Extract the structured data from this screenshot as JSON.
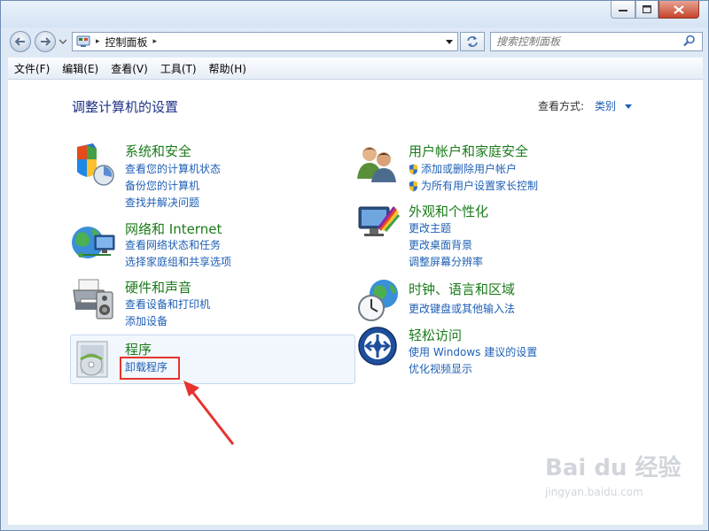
{
  "window": {
    "title": "",
    "controls": {
      "minimize": "minimize",
      "maximize": "maximize",
      "close": "close"
    }
  },
  "address": {
    "path": "控制面板",
    "separator": "▸"
  },
  "search": {
    "placeholder": "搜索控制面板"
  },
  "menu": {
    "items": [
      "文件(F)",
      "编辑(E)",
      "查看(V)",
      "工具(T)",
      "帮助(H)"
    ]
  },
  "content": {
    "heading": "调整计算机的设置",
    "view_by_label": "查看方式:",
    "view_by_value": "类别",
    "categories": [
      {
        "title": "系统和安全",
        "links": [
          "查看您的计算机状态",
          "备份您的计算机",
          "查找并解决问题"
        ]
      },
      {
        "title": "网络和 Internet",
        "links": [
          "查看网络状态和任务",
          "选择家庭组和共享选项"
        ]
      },
      {
        "title": "硬件和声音",
        "links": [
          "查看设备和打印机",
          "添加设备"
        ]
      },
      {
        "title": "程序",
        "links": [
          "卸载程序"
        ]
      },
      {
        "title": "用户帐户和家庭安全",
        "links": [
          "添加或删除用户帐户",
          "为所有用户设置家长控制"
        ]
      },
      {
        "title": "外观和个性化",
        "links": [
          "更改主题",
          "更改桌面背景",
          "调整屏幕分辨率"
        ]
      },
      {
        "title": "时钟、语言和区域",
        "links": [
          "更改键盘或其他输入法"
        ]
      },
      {
        "title": "轻松访问",
        "links": [
          "使用 Windows 建议的设置",
          "优化视频显示"
        ]
      }
    ]
  },
  "watermark": {
    "brand": "Bai du 经验",
    "url": "jingyan.baidu.com"
  },
  "colors": {
    "title_green": "#1b7b1b",
    "link_blue": "#1e5fb5",
    "heading_blue": "#1e3287",
    "highlight_red": "#e6332f"
  }
}
